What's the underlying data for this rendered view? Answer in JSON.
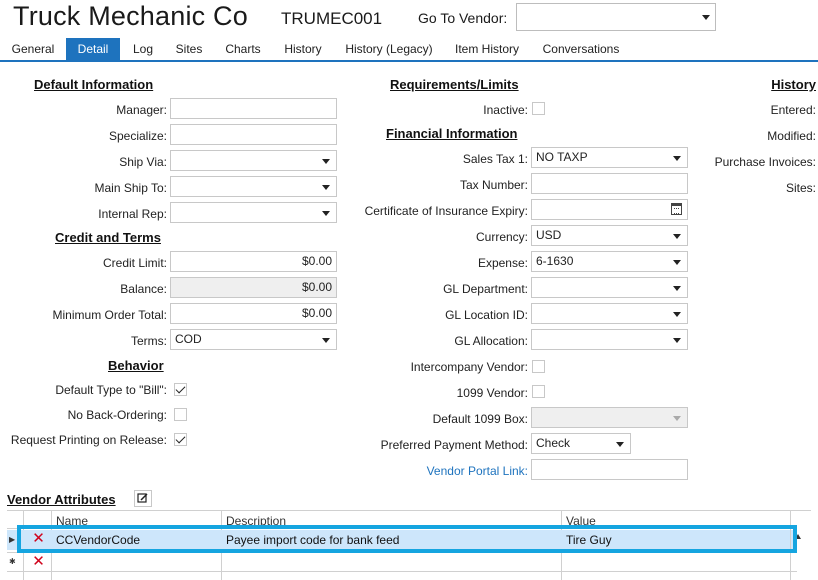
{
  "header": {
    "title": "Truck Mechanic Co",
    "code": "TRUMEC001",
    "goto_label": "Go To Vendor:",
    "goto_value": ""
  },
  "tabs": [
    {
      "label": "General"
    },
    {
      "label": "Detail",
      "active": true
    },
    {
      "label": "Log"
    },
    {
      "label": "Sites"
    },
    {
      "label": "Charts"
    },
    {
      "label": "History"
    },
    {
      "label": "History (Legacy)"
    },
    {
      "label": "Item History"
    },
    {
      "label": "Conversations"
    }
  ],
  "default_info": {
    "title": "Default Information",
    "manager": {
      "label": "Manager:",
      "value": ""
    },
    "specialize": {
      "label": "Specialize:",
      "value": ""
    },
    "ship_via": {
      "label": "Ship Via:",
      "value": ""
    },
    "main_ship_to": {
      "label": "Main Ship To:",
      "value": ""
    },
    "internal_rep": {
      "label": "Internal Rep:",
      "value": ""
    }
  },
  "credit": {
    "title": "Credit and Terms",
    "credit_limit": {
      "label": "Credit Limit:",
      "value": "$0.00"
    },
    "balance": {
      "label": "Balance:",
      "value": "$0.00"
    },
    "min_order": {
      "label": "Minimum Order Total:",
      "value": "$0.00"
    },
    "terms": {
      "label": "Terms:",
      "value": "COD"
    }
  },
  "behavior": {
    "title": "Behavior",
    "default_type": {
      "label": "Default Type to \"Bill\":",
      "checked": true
    },
    "no_backorder": {
      "label": "No Back-Ordering:",
      "checked": false
    },
    "request_printing": {
      "label": "Request Printing on Release:",
      "checked": true
    }
  },
  "requirements": {
    "title": "Requirements/Limits",
    "inactive": {
      "label": "Inactive:",
      "checked": false
    }
  },
  "financial": {
    "title": "Financial Information",
    "sales_tax": {
      "label": "Sales Tax 1:",
      "value": "NO TAXP"
    },
    "tax_number": {
      "label": "Tax Number:",
      "value": ""
    },
    "coi_expiry": {
      "label": "Certificate of Insurance Expiry:",
      "value": ""
    },
    "currency": {
      "label": "Currency:",
      "value": "USD"
    },
    "expense": {
      "label": "Expense:",
      "value": "6-1630"
    },
    "gl_department": {
      "label": "GL Department:",
      "value": ""
    },
    "gl_location": {
      "label": "GL Location ID:",
      "value": ""
    },
    "gl_allocation": {
      "label": "GL Allocation:",
      "value": ""
    },
    "intercompany": {
      "label": "Intercompany Vendor:",
      "checked": false
    },
    "vendor_1099": {
      "label": "1099 Vendor:",
      "checked": false
    },
    "default_1099_box": {
      "label": "Default 1099 Box:",
      "value": ""
    },
    "payment_method": {
      "label": "Preferred Payment Method:",
      "value": "Check"
    },
    "portal_link": {
      "label": "Vendor Portal Link:",
      "value": ""
    }
  },
  "history": {
    "title": "History",
    "entered": "Entered:",
    "modified": "Modified:",
    "purchase_invoices": "Purchase Invoices:",
    "sites": "Sites:"
  },
  "vendor_attributes": {
    "title": "Vendor Attributes",
    "columns": [
      "Name",
      "Description",
      "Value"
    ],
    "rows": [
      {
        "name": "CCVendorCode",
        "description": "Payee import code for bank feed",
        "value": "Tire Guy"
      },
      {
        "name": "",
        "description": "",
        "value": ""
      }
    ]
  },
  "colors": {
    "accent": "#1e73be",
    "highlight_border": "#15a5e0",
    "selected_row": "#cde6fb",
    "delete_icon": "#d0021b"
  }
}
